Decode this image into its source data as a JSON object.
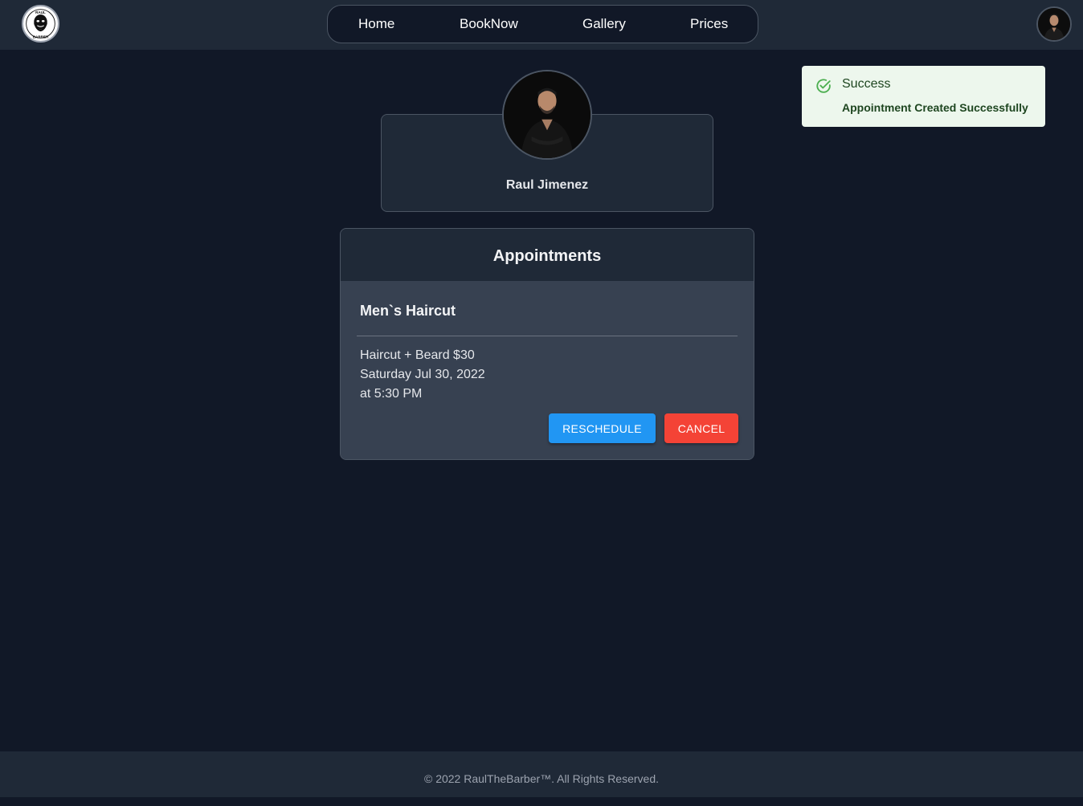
{
  "header": {
    "logo_icon": "bearded-barber-logo",
    "logo_text_top": "RAUL",
    "logo_text_bottom": "BARBER",
    "nav": [
      {
        "label": "Home"
      },
      {
        "label": "BookNow"
      },
      {
        "label": "Gallery"
      },
      {
        "label": "Prices"
      }
    ],
    "user_avatar_icon": "user-avatar"
  },
  "toast": {
    "icon": "check-circle-icon",
    "title": "Success",
    "message": "Appointment Created Successfully",
    "color": "#2e7d32"
  },
  "profile": {
    "photo_icon": "barber-portrait",
    "name": "Raul Jimenez"
  },
  "appointments": {
    "heading": "Appointments",
    "items": [
      {
        "service": "Men`s Haircut",
        "package": "Haircut + Beard $30",
        "date": "Saturday Jul 30, 2022",
        "time": "at 5:30 PM",
        "reschedule_label": "RESCHEDULE",
        "cancel_label": "CANCEL"
      }
    ]
  },
  "colors": {
    "background": "#111827",
    "bar": "#1f2937",
    "reschedule": "#2196f3",
    "cancel": "#f44336"
  },
  "footer": {
    "text": "© 2022 RaulTheBarber™. All Rights Reserved."
  }
}
